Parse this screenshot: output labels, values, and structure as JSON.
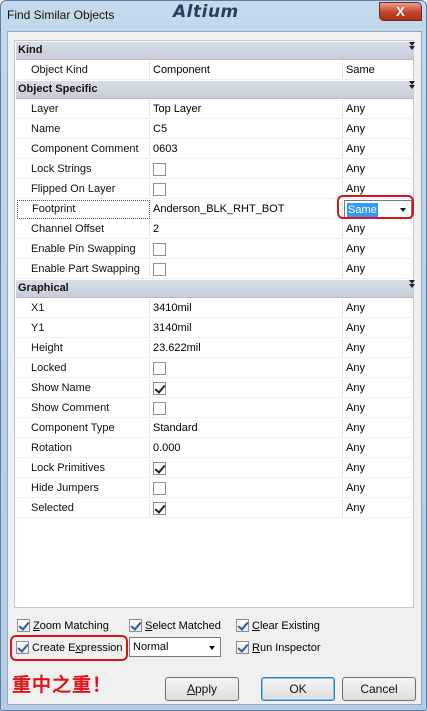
{
  "window": {
    "title": "Find Similar Objects",
    "brand": "Altium",
    "close_glyph": "X"
  },
  "sections": [
    {
      "title": "Kind",
      "rows": [
        {
          "name": "Object Kind",
          "value": "Component",
          "operator": "Same"
        }
      ]
    },
    {
      "title": "Object Specific",
      "rows": [
        {
          "name": "Layer",
          "value": "Top Layer",
          "operator": "Any"
        },
        {
          "name": "Name",
          "value": "C5",
          "operator": "Any"
        },
        {
          "name": "Component Comment",
          "value": "0603",
          "operator": "Any"
        },
        {
          "name": "Lock Strings",
          "checkbox": false,
          "operator": "Any"
        },
        {
          "name": "Flipped On Layer",
          "checkbox": false,
          "operator": "Any"
        },
        {
          "name": "Footprint",
          "value": "Anderson_BLK_RHT_BOT",
          "operator": "Same",
          "selected": true
        },
        {
          "name": "Channel Offset",
          "value": "2",
          "operator": "Any"
        },
        {
          "name": "Enable Pin Swapping",
          "checkbox": false,
          "operator": "Any"
        },
        {
          "name": "Enable Part Swapping",
          "checkbox": false,
          "operator": "Any"
        }
      ]
    },
    {
      "title": "Graphical",
      "rows": [
        {
          "name": "X1",
          "value": "3410mil",
          "operator": "Any"
        },
        {
          "name": "Y1",
          "value": "3140mil",
          "operator": "Any"
        },
        {
          "name": "Height",
          "value": "23.622mil",
          "operator": "Any"
        },
        {
          "name": "Locked",
          "checkbox": false,
          "operator": "Any"
        },
        {
          "name": "Show Name",
          "checkbox": true,
          "operator": "Any"
        },
        {
          "name": "Show Comment",
          "checkbox": false,
          "operator": "Any"
        },
        {
          "name": "Component Type",
          "value": "Standard",
          "operator": "Any"
        },
        {
          "name": "Rotation",
          "value": "0.000",
          "operator": "Any"
        },
        {
          "name": "Lock Primitives",
          "checkbox": true,
          "operator": "Any"
        },
        {
          "name": "Hide Jumpers",
          "checkbox": false,
          "operator": "Any"
        },
        {
          "name": "Selected",
          "checkbox": true,
          "operator": "Any"
        }
      ]
    }
  ],
  "options": {
    "zoom_matching": {
      "label_pre": "",
      "label_u": "Z",
      "label_post": "oom Matching",
      "checked": true
    },
    "select_matched": {
      "label_pre": "",
      "label_u": "S",
      "label_post": "elect Matched",
      "checked": true
    },
    "clear_existing": {
      "label_pre": "",
      "label_u": "C",
      "label_post": "lear Existing",
      "checked": true
    },
    "create_expression": {
      "label_pre": "Create E",
      "label_u": "x",
      "label_post": "pression",
      "checked": true
    },
    "mask_mode": "Normal",
    "run_inspector": {
      "label_pre": "",
      "label_u": "R",
      "label_post": "un Inspector",
      "checked": true
    }
  },
  "annotation": "重中之重！",
  "buttons": {
    "apply": {
      "label_pre": "",
      "label_u": "A",
      "label_post": "pply"
    },
    "ok": "OK",
    "cancel": "Cancel"
  },
  "colors": {
    "highlight": "#d8151a",
    "selection": "#3399ff"
  },
  "icons": [
    "collapse-arrow-icon",
    "close-icon",
    "dropdown-arrow-icon",
    "checkbox-icon"
  ]
}
